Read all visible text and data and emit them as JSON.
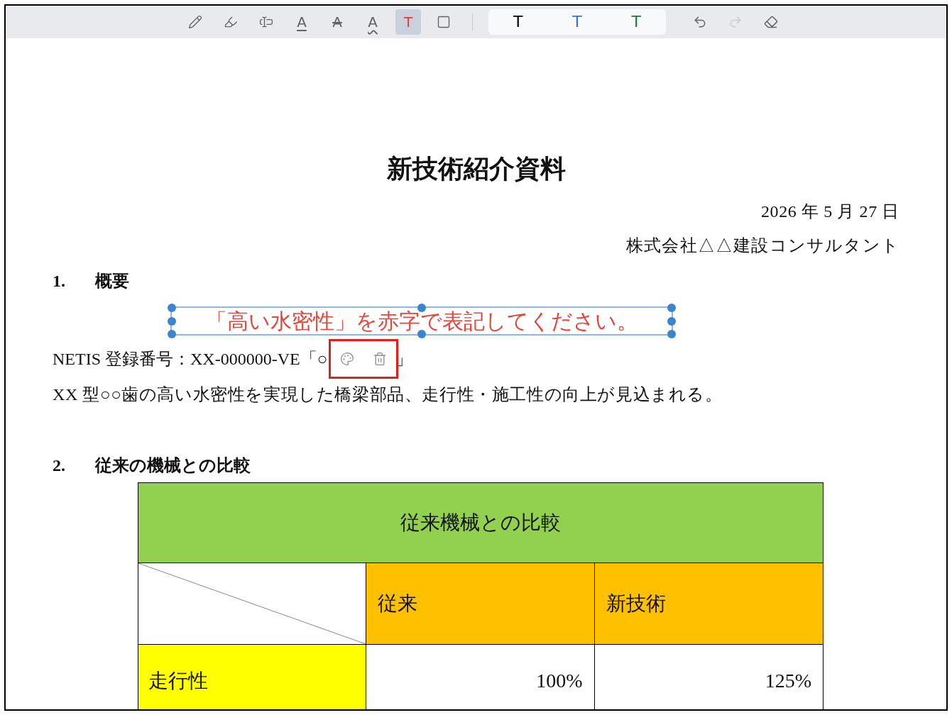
{
  "toolbar": {
    "tools": [
      {
        "kind": "pen",
        "selected": false
      },
      {
        "kind": "highlighter",
        "selected": false
      },
      {
        "kind": "textbox",
        "selected": false
      },
      {
        "kind": "underline",
        "label": "A",
        "selected": false
      },
      {
        "kind": "strikethrough",
        "label": "A",
        "selected": false
      },
      {
        "kind": "wavy",
        "label": "A",
        "selected": false
      },
      {
        "kind": "text",
        "label": "T",
        "selected": true
      },
      {
        "kind": "rectangle",
        "selected": false
      }
    ],
    "colors": [
      {
        "label": "T",
        "color": "#000000",
        "selected": false
      },
      {
        "label": "T",
        "color": "#3b6fd8",
        "selected": false
      },
      {
        "label": "T",
        "color": "#1e7a3a",
        "selected": false
      }
    ],
    "history": [
      {
        "kind": "undo",
        "disabled": false
      },
      {
        "kind": "redo",
        "disabled": true
      },
      {
        "kind": "eraser",
        "disabled": false
      }
    ]
  },
  "document": {
    "title": "新技術紹介資料",
    "date": "2026 年 5 月 27 日",
    "company": "株式会社△△建設コンサルタント",
    "section_1": {
      "number": "1.",
      "heading": "概要"
    },
    "netis_line": {
      "visible_start": "NETIS 登録番号：XX-000000-VE「○",
      "visible_end": "」"
    },
    "description": "XX 型○○歯の高い水密性を実現した橋梁部品、走行性・施工性の向上が見込まれる。",
    "section_2": {
      "number": "2.",
      "heading": "従来の機械との比較"
    },
    "table": {
      "caption": "従来機械との比較",
      "columns": [
        "従来",
        "新技術"
      ],
      "rows": [
        {
          "label": "走行性",
          "cells": [
            "100%",
            "125%"
          ]
        }
      ]
    }
  },
  "annotation": {
    "text": "「高い水密性」を赤字で表記してください。",
    "color": "#e5453a",
    "selected": true
  }
}
